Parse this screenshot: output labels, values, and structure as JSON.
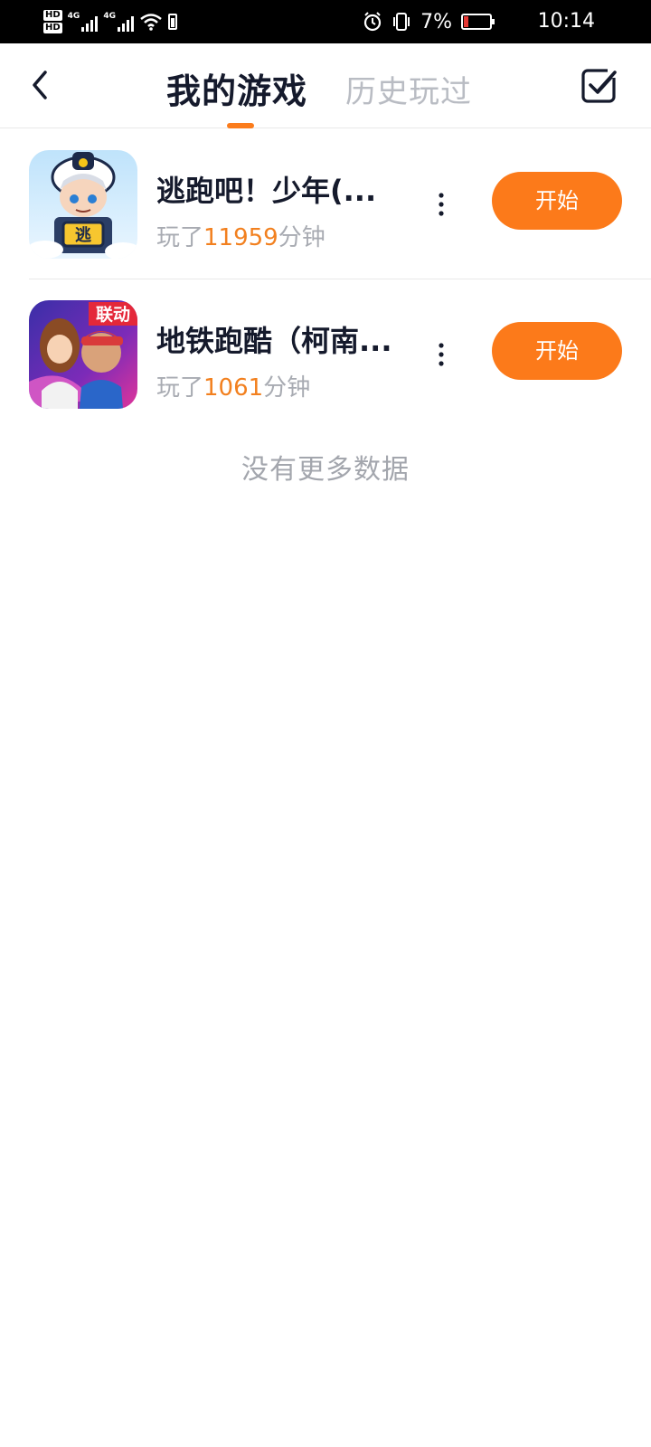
{
  "status_bar": {
    "left_tags": [
      "HD",
      "HD",
      "4G",
      "4G"
    ],
    "battery_percent": "7%",
    "time": "10:14",
    "icons": [
      "alarm-icon",
      "vibrate-icon",
      "battery-icon",
      "wifi-icon",
      "signal-icon"
    ],
    "battery_color": "#e53935"
  },
  "header": {
    "tabs": [
      {
        "label": "我的游戏",
        "active": true
      },
      {
        "label": "历史玩过",
        "active": false
      }
    ],
    "back_icon": "chevron-left-icon",
    "edit_icon": "checkbox-edit-icon",
    "accent_color": "#fc7a1a"
  },
  "games": [
    {
      "title": "逃跑吧！少年(...",
      "played_prefix": "玩了",
      "minutes": "11959",
      "played_suffix": "分钟",
      "button": "开始",
      "icon_text": "逃"
    },
    {
      "title": "地铁跑酷（柯南...",
      "played_prefix": "玩了",
      "minutes": "1061",
      "played_suffix": "分钟",
      "button": "开始",
      "icon_text": "联动"
    }
  ],
  "footer_text": "没有更多数据"
}
